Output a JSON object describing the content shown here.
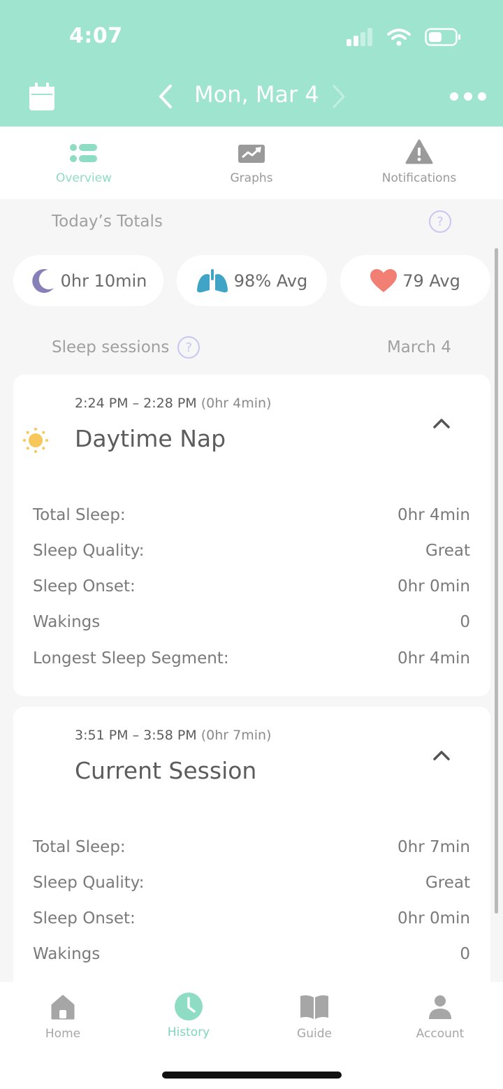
{
  "status": {
    "time": "4:07"
  },
  "nav": {
    "date": "Mon, Mar 4"
  },
  "tabs": [
    {
      "label": "Overview",
      "active": true,
      "icon": "list-icon"
    },
    {
      "label": "Graphs",
      "active": false,
      "icon": "chart-icon"
    },
    {
      "label": "Notifications",
      "active": false,
      "icon": "warning-icon"
    }
  ],
  "totals": {
    "title": "Today’s Totals",
    "help": "?",
    "sleep": "0hr 10min",
    "oxygen": "98% Avg",
    "heart": "79 Avg"
  },
  "sessions": {
    "title": "Sleep sessions",
    "help": "?",
    "date": "March 4",
    "items": [
      {
        "time": "2:24 PM – 2:28 PM",
        "duration": "(0hr 4min)",
        "title": "Daytime Nap",
        "stats": [
          {
            "label": "Total Sleep:",
            "value": "0hr 4min"
          },
          {
            "label": "Sleep Quality:",
            "value": "Great"
          },
          {
            "label": "Sleep Onset:",
            "value": "0hr 0min"
          },
          {
            "label": "Wakings",
            "value": "0"
          },
          {
            "label": "Longest Sleep Segment:",
            "value": "0hr 4min"
          }
        ]
      },
      {
        "time": "3:51 PM – 3:58 PM",
        "duration": "(0hr 7min)",
        "title": "Current Session",
        "stats": [
          {
            "label": "Total Sleep:",
            "value": "0hr 7min"
          },
          {
            "label": "Sleep Quality:",
            "value": "Great"
          },
          {
            "label": "Sleep Onset:",
            "value": "0hr 0min"
          },
          {
            "label": "Wakings",
            "value": "0"
          }
        ]
      }
    ]
  },
  "bottom_nav": [
    {
      "label": "Home",
      "active": false,
      "icon": "home-icon"
    },
    {
      "label": "History",
      "active": true,
      "icon": "clock-icon"
    },
    {
      "label": "Guide",
      "active": false,
      "icon": "book-icon"
    },
    {
      "label": "Account",
      "active": false,
      "icon": "person-icon"
    }
  ],
  "colors": {
    "header": "#9fe4cf",
    "accent": "#8fdcc4",
    "moon": "#8680b8",
    "lungs": "#3fa4c6",
    "heart": "#f27f73",
    "sun": "#f8c75a"
  }
}
